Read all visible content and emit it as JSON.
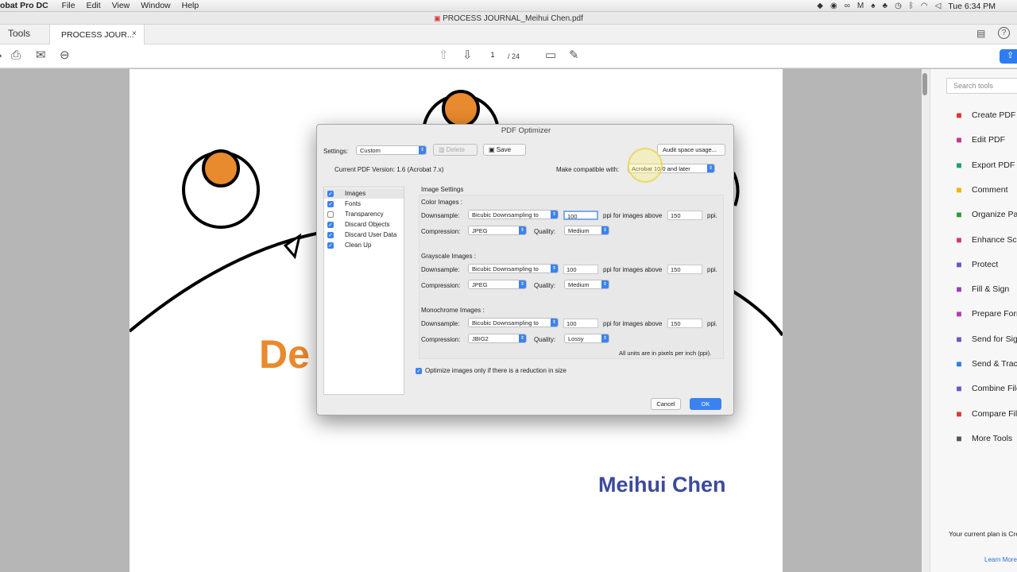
{
  "menubar": {
    "app": "obat Pro DC",
    "items": [
      "File",
      "Edit",
      "View",
      "Window",
      "Help"
    ],
    "status_icons": [
      "dropbox-icon",
      "record-icon",
      "creative-cloud-icon",
      "malwarebytes-icon",
      "flame-icon",
      "notification-icon",
      "time-machine-icon",
      "bluetooth-icon",
      "wifi-icon",
      "volume-icon"
    ],
    "clock": "Tue 6:34 PM"
  },
  "window": {
    "title": "PROCESS JOURNAL_Meihui Chen.pdf"
  },
  "tabs": {
    "tools": "Tools",
    "doc": "PROCESS JOUR...",
    "close": "×"
  },
  "toolbar": {
    "page": "1",
    "total": "/ 24"
  },
  "document": {
    "heading_partial": "De",
    "author": "Meihui Chen"
  },
  "right_panel": {
    "search_placeholder": "Search tools",
    "items": [
      {
        "label": "Create PDF",
        "icon": "create-pdf-icon",
        "color": "#e2322f"
      },
      {
        "label": "Edit PDF",
        "icon": "edit-pdf-icon",
        "color": "#c2388f"
      },
      {
        "label": "Export PDF",
        "icon": "export-pdf-icon",
        "color": "#1a9e7a"
      },
      {
        "label": "Comment",
        "icon": "comment-icon",
        "color": "#f0b400"
      },
      {
        "label": "Organize Pag",
        "icon": "organize-pages-icon",
        "color": "#2f9c3a"
      },
      {
        "label": "Enhance Sca",
        "icon": "enhance-scan-icon",
        "color": "#d63a6a"
      },
      {
        "label": "Protect",
        "icon": "protect-icon",
        "color": "#6a58c8"
      },
      {
        "label": "Fill & Sign",
        "icon": "fill-sign-icon",
        "color": "#9b3fb6"
      },
      {
        "label": "Prepare Form",
        "icon": "prepare-form-icon",
        "color": "#b63ab0"
      },
      {
        "label": "Send for Sign",
        "icon": "send-for-signature-icon",
        "color": "#6a58c8"
      },
      {
        "label": "Send & Track",
        "icon": "send-track-icon",
        "color": "#2b7fd8"
      },
      {
        "label": "Combine File",
        "icon": "combine-files-icon",
        "color": "#6a58c8"
      },
      {
        "label": "Compare File",
        "icon": "compare-files-icon",
        "color": "#d63a3a"
      },
      {
        "label": "More Tools",
        "icon": "more-tools-icon",
        "color": "#555555"
      }
    ],
    "plan": "Your current plan is Cre",
    "learn_more": "Learn More"
  },
  "dialog": {
    "title": "PDF Optimizer",
    "settings_label": "Settings:",
    "settings_value": "Custom",
    "delete": "Delete",
    "save": "Save",
    "audit": "Audit space usage...",
    "version": "Current PDF Version: 1.6 (Acrobat 7.x)",
    "compat_label": "Make compatible with:",
    "compat_value": "Acrobat 10.0 and later",
    "panels": [
      {
        "label": "Images",
        "checked": true
      },
      {
        "label": "Fonts",
        "checked": true
      },
      {
        "label": "Transparency",
        "checked": false
      },
      {
        "label": "Discard Objects",
        "checked": true
      },
      {
        "label": "Discard User Data",
        "checked": true
      },
      {
        "label": "Clean Up",
        "checked": true
      }
    ],
    "image_settings": "Image Settings",
    "groups": [
      {
        "title": "Color Images :",
        "downsample": "Bicubic Downsampling to",
        "ppi": "100",
        "above": "150",
        "compression": "JPEG",
        "quality": "Medium"
      },
      {
        "title": "Grayscale Images :",
        "downsample": "Bicubic Downsampling to",
        "ppi": "100",
        "above": "150",
        "compression": "JPEG",
        "quality": "Medium"
      },
      {
        "title": "Monochrome Images :",
        "downsample": "Bicubic Downsampling to",
        "ppi": "100",
        "above": "150",
        "compression": "JBIG2",
        "quality": "Lossy"
      }
    ],
    "downsample_label": "Downsample:",
    "compression_label": "Compression:",
    "quality_label": "Quality:",
    "ppi_above_label": "ppi for images above",
    "ppi_unit": "ppi.",
    "units_note": "All units are in pixels per inch (ppi).",
    "optimize_only": "Optimize images only if there is a reduction in size",
    "cancel": "Cancel",
    "ok": "OK"
  }
}
